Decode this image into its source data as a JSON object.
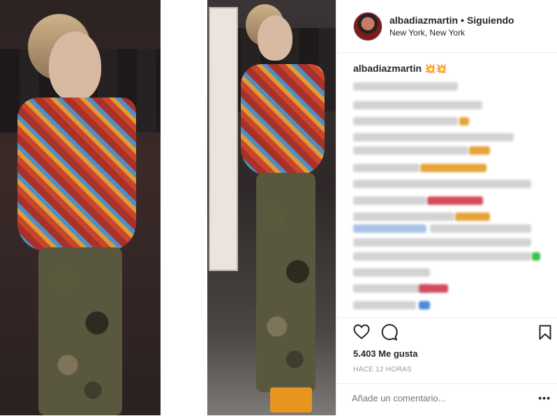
{
  "post": {
    "username": "albadiazmartin",
    "separator": "•",
    "follow_status": "Siguiendo",
    "location": "New York, New York",
    "caption_user": "albadiazmartin",
    "caption_emoji": "💥💥",
    "likes": "5.403 Me gusta",
    "timestamp": "HACE 12 HORAS",
    "comment_placeholder": "Añade un comentario...",
    "more_label": "•••"
  },
  "icons": {
    "like": "heart-icon",
    "comment": "comment-bubble-icon",
    "save": "bookmark-icon",
    "more": "more-options-icon"
  },
  "colors": {
    "text": "#262626",
    "muted": "#999999",
    "border": "#efefef"
  }
}
